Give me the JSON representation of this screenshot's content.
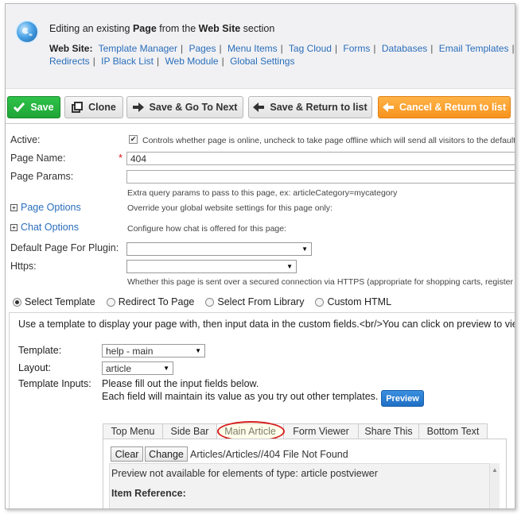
{
  "header": {
    "editing_prefix": "Editing an existing ",
    "editing_entity": "Page",
    "editing_middle": " from the ",
    "editing_section": "Web Site",
    "editing_suffix": " section",
    "nav_label": "Web Site:",
    "nav_row1": [
      "Template Manager",
      "Pages",
      "Menu Items",
      "Tag Cloud",
      "Forms",
      "Databases",
      "Email Templates",
      "S"
    ],
    "nav_row2": [
      "Redirects",
      "IP Black List",
      "Web Module",
      "Global Settings"
    ]
  },
  "toolbar": {
    "save": "Save",
    "clone": "Clone",
    "save_next": "Save & Go To Next",
    "save_return": "Save & Return to list",
    "cancel_return": "Cancel & Return to list"
  },
  "form": {
    "active_label": "Active:",
    "active_hint": "Controls whether page is online, uncheck to take page offline which will send all visitors to the default s",
    "page_name_label": "Page Name:",
    "page_name_required": "*",
    "page_name_value": "404",
    "page_params_label": "Page Params:",
    "page_params_value": "",
    "page_params_hint": "Extra query params to pass to this page, ex: articleCategory=mycategory",
    "page_options_label": "Page Options",
    "page_options_hint": "Override your global website settings for this page only:",
    "chat_options_label": "Chat Options",
    "chat_options_hint": "Configure how chat is offered for this page:",
    "default_plugin_label": "Default Page For Plugin:",
    "default_plugin_value": "",
    "https_label": "Https:",
    "https_value": "",
    "https_hint": "Whether this page is sent over a secured connection via HTTPS (appropriate for shopping carts, register for"
  },
  "mode": {
    "options": [
      "Select Template",
      "Redirect To Page",
      "Select From Library",
      "Custom HTML"
    ],
    "selected": "Select Template"
  },
  "template": {
    "intro": "Use a template to display your page with, then input data in the custom fields.<br/>You can click on preview to view",
    "template_label": "Template:",
    "template_value": "help - main",
    "layout_label": "Layout:",
    "layout_value": "article",
    "inputs_label": "Template Inputs:",
    "inputs_line1": "Please fill out the input fields below.",
    "inputs_line2": "Each field will maintain its value as you try out other templates.",
    "preview_button": "Preview"
  },
  "tabs": {
    "items": [
      "Top Menu",
      "Side Bar",
      "Main Article",
      "Form Viewer",
      "Share This",
      "Bottom Text"
    ],
    "active": "Main Article"
  },
  "article": {
    "clear": "Clear",
    "change": "Change",
    "path": "Articles/Articles//404 File Not Found",
    "preview_msg": "Preview not available for elements of type: article postviewer",
    "item_ref": "Item Reference:"
  },
  "colors": {
    "link": "#2a6ebb",
    "save_green": "#1ea536",
    "cancel_orange": "#f7931e",
    "highlight_red": "#d81e1e"
  }
}
